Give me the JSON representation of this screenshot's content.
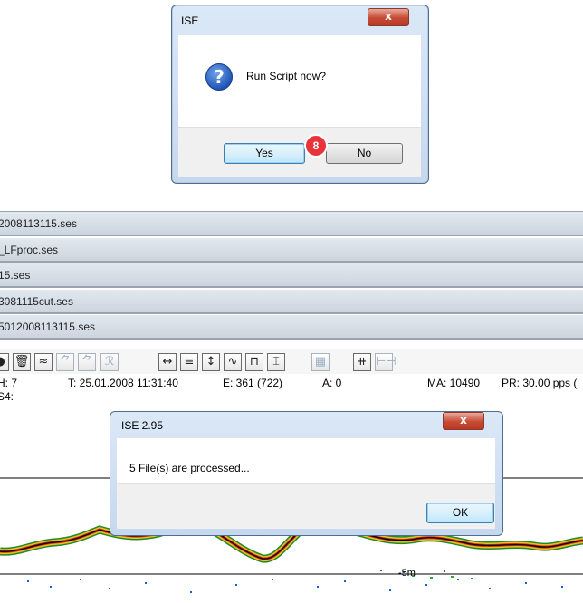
{
  "dialog_confirm": {
    "title": "ISE",
    "close_glyph": "x",
    "icon": "question-icon",
    "message": "Run Script now?",
    "yes_label": "Yes",
    "no_label": "No",
    "step_badge": "8"
  },
  "app": {
    "files": [
      "2008113115.ses",
      "_LFproc.ses",
      "15.ses",
      "3081115cut.ses",
      "5012008113115.ses"
    ],
    "toolbar_icons": [
      "circle-icon",
      "trash-icon",
      "wave-filter-icon",
      "spike-icon",
      "spike-cluster-icon",
      "zoom-icon",
      "horizontal-expand-icon",
      "align-center-icon",
      "vertical-expand-icon",
      "sine-icon",
      "pulse-icon",
      "tide-icon",
      "grid-icon",
      "marker-icon",
      "range-icon"
    ],
    "toolbar_glyphs": [
      "●",
      "🗑",
      "≈",
      "⺈",
      "⺈",
      "ℛ",
      "↔",
      "≡",
      "↕",
      "∿",
      "⊓",
      "⌶",
      "▦",
      "⧺",
      "⊢⊣"
    ],
    "status": {
      "h": "H:  7",
      "t": "T: 25.01.2008 11:31:40",
      "e": "E:  361 (722)",
      "a": "A:  0",
      "ma": "MA: 10490",
      "pr": "PR: 30.00 pps (",
      "s4": "S4:"
    },
    "depth_label": "-5m"
  },
  "dialog_info": {
    "title": "ISE 2.95",
    "close_glyph": "x",
    "message": "5 File(s) are processed...",
    "ok_label": "OK"
  }
}
